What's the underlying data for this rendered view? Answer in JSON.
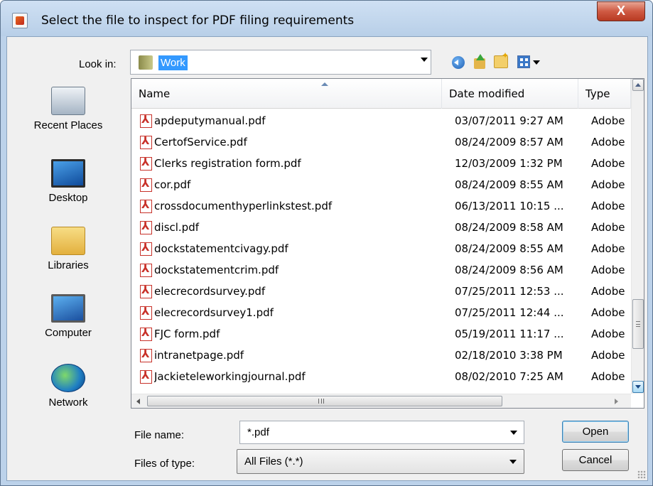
{
  "window": {
    "title": "Select the file to inspect for PDF filing requirements",
    "close_label": "X"
  },
  "toolbar": {
    "look_in_label": "Look in:",
    "look_in_value": "Work",
    "icons": [
      "back-icon",
      "up-folder-icon",
      "new-folder-icon",
      "view-menu-icon"
    ]
  },
  "places": [
    {
      "label": "Recent Places",
      "icon": "recent-places-icon"
    },
    {
      "label": "Desktop",
      "icon": "desktop-icon"
    },
    {
      "label": "Libraries",
      "icon": "libraries-icon"
    },
    {
      "label": "Computer",
      "icon": "computer-icon"
    },
    {
      "label": "Network",
      "icon": "network-icon"
    }
  ],
  "filelist": {
    "columns": {
      "name": "Name",
      "date": "Date modified",
      "type": "Type"
    },
    "rows": [
      {
        "name": "apdeputymanual.pdf",
        "date": "03/07/2011 9:27 AM",
        "type": "Adobe"
      },
      {
        "name": "CertofService.pdf",
        "date": "08/24/2009 8:57 AM",
        "type": "Adobe"
      },
      {
        "name": "Clerks registration form.pdf",
        "date": "12/03/2009 1:32 PM",
        "type": "Adobe"
      },
      {
        "name": "cor.pdf",
        "date": "08/24/2009 8:55 AM",
        "type": "Adobe"
      },
      {
        "name": "crossdocumenthyperlinkstest.pdf",
        "date": "06/13/2011 10:15 ...",
        "type": "Adobe"
      },
      {
        "name": "discl.pdf",
        "date": "08/24/2009 8:58 AM",
        "type": "Adobe"
      },
      {
        "name": "dockstatementcivagy.pdf",
        "date": "08/24/2009 8:55 AM",
        "type": "Adobe"
      },
      {
        "name": "dockstatementcrim.pdf",
        "date": "08/24/2009 8:56 AM",
        "type": "Adobe"
      },
      {
        "name": "elecrecordsurvey.pdf",
        "date": "07/25/2011 12:53 ...",
        "type": "Adobe"
      },
      {
        "name": "elecrecordsurvey1.pdf",
        "date": "07/25/2011 12:44 ...",
        "type": "Adobe"
      },
      {
        "name": "FJC form.pdf",
        "date": "05/19/2011 11:17 ...",
        "type": "Adobe"
      },
      {
        "name": "intranetpage.pdf",
        "date": "02/18/2010 3:38 PM",
        "type": "Adobe"
      },
      {
        "name": "Jackieteleworkingjournal.pdf",
        "date": "08/02/2010 7:25 AM",
        "type": "Adobe"
      }
    ]
  },
  "form": {
    "file_name_label": "File name:",
    "file_name_value": "*.pdf",
    "files_of_type_label": "Files of type:",
    "files_of_type_value": "All Files (*.*)"
  },
  "buttons": {
    "open": "Open",
    "cancel": "Cancel"
  }
}
